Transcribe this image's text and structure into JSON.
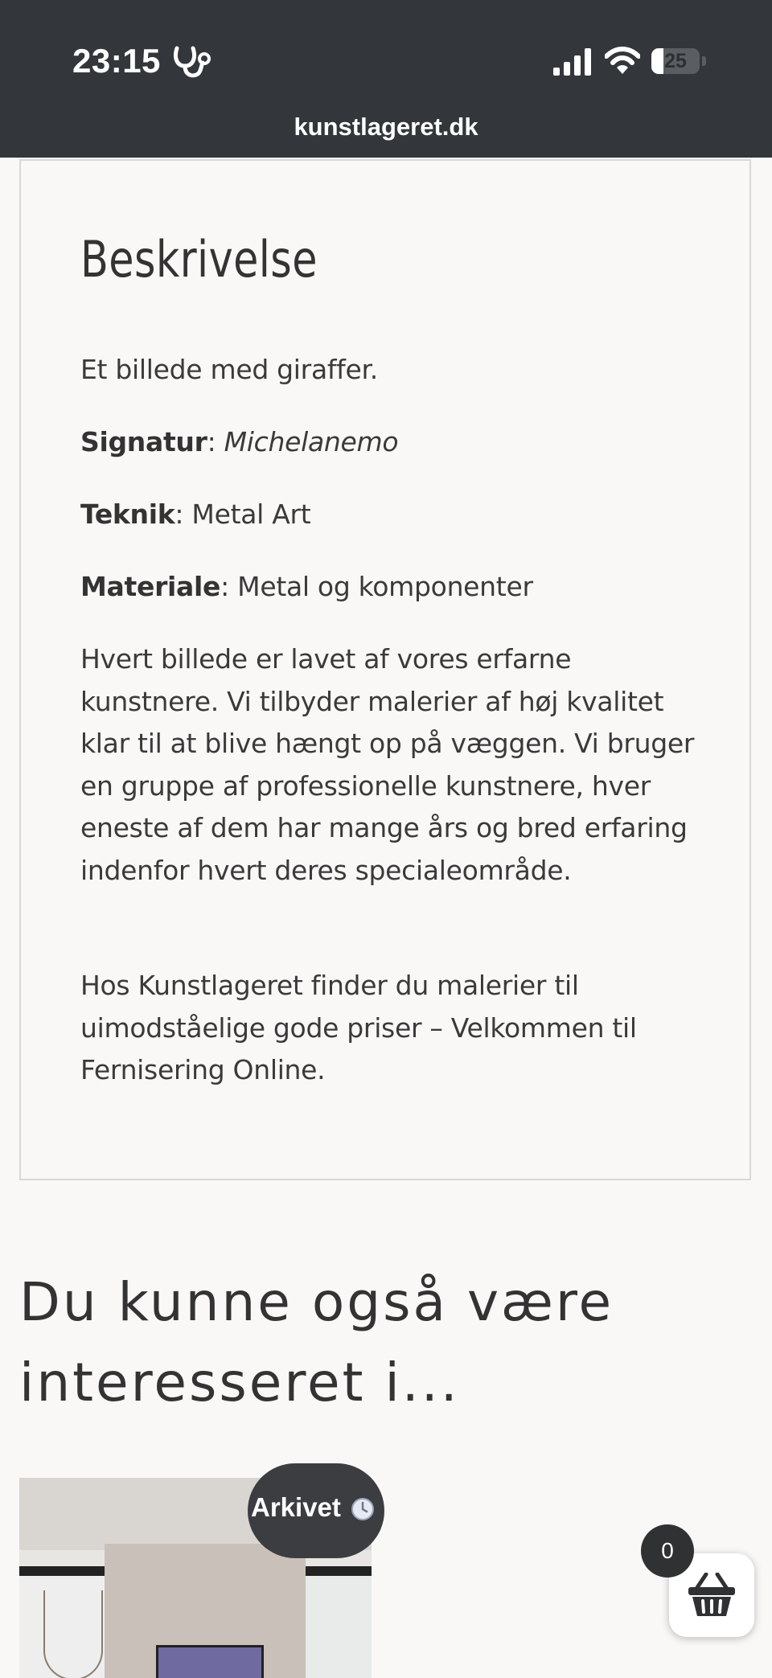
{
  "status_bar": {
    "time": "23:15",
    "battery": "25",
    "icons": [
      "stethoscope-icon",
      "cellular-signal-icon",
      "wifi-icon",
      "battery-icon"
    ]
  },
  "browser": {
    "url": "kunstlageret.dk"
  },
  "description": {
    "title": "Beskrivelse",
    "intro": "Et billede med giraffer.",
    "signatur_label": "Signatur",
    "signatur_value": "Michelanemo",
    "teknik_label": "Teknik",
    "teknik_value": "Metal Art",
    "materiale_label": "Materiale",
    "materiale_value": "Metal og komponenter",
    "separator": ": ",
    "paragraph_1": "Hvert billede er lavet af vores erfarne kunstnere. Vi tilbyder malerier af høj kvalitet klar til at blive hængt op på væggen. Vi bruger en gruppe af professionelle kunstnere, hver eneste af dem har mange års og bred erfaring indenfor hvert deres specialeområde.",
    "paragraph_2": "Hos Kunstlageret finder du malerier til uimodståelige gode priser – Velkommen til Fernisering Online."
  },
  "related": {
    "title": "Du kunne også være interesseret i...",
    "badge": "Arkivet"
  },
  "cart": {
    "count": "0"
  },
  "colors": {
    "topbar": "#33363a",
    "page_background": "#f9f8f6",
    "badge": "#3c3d40"
  }
}
